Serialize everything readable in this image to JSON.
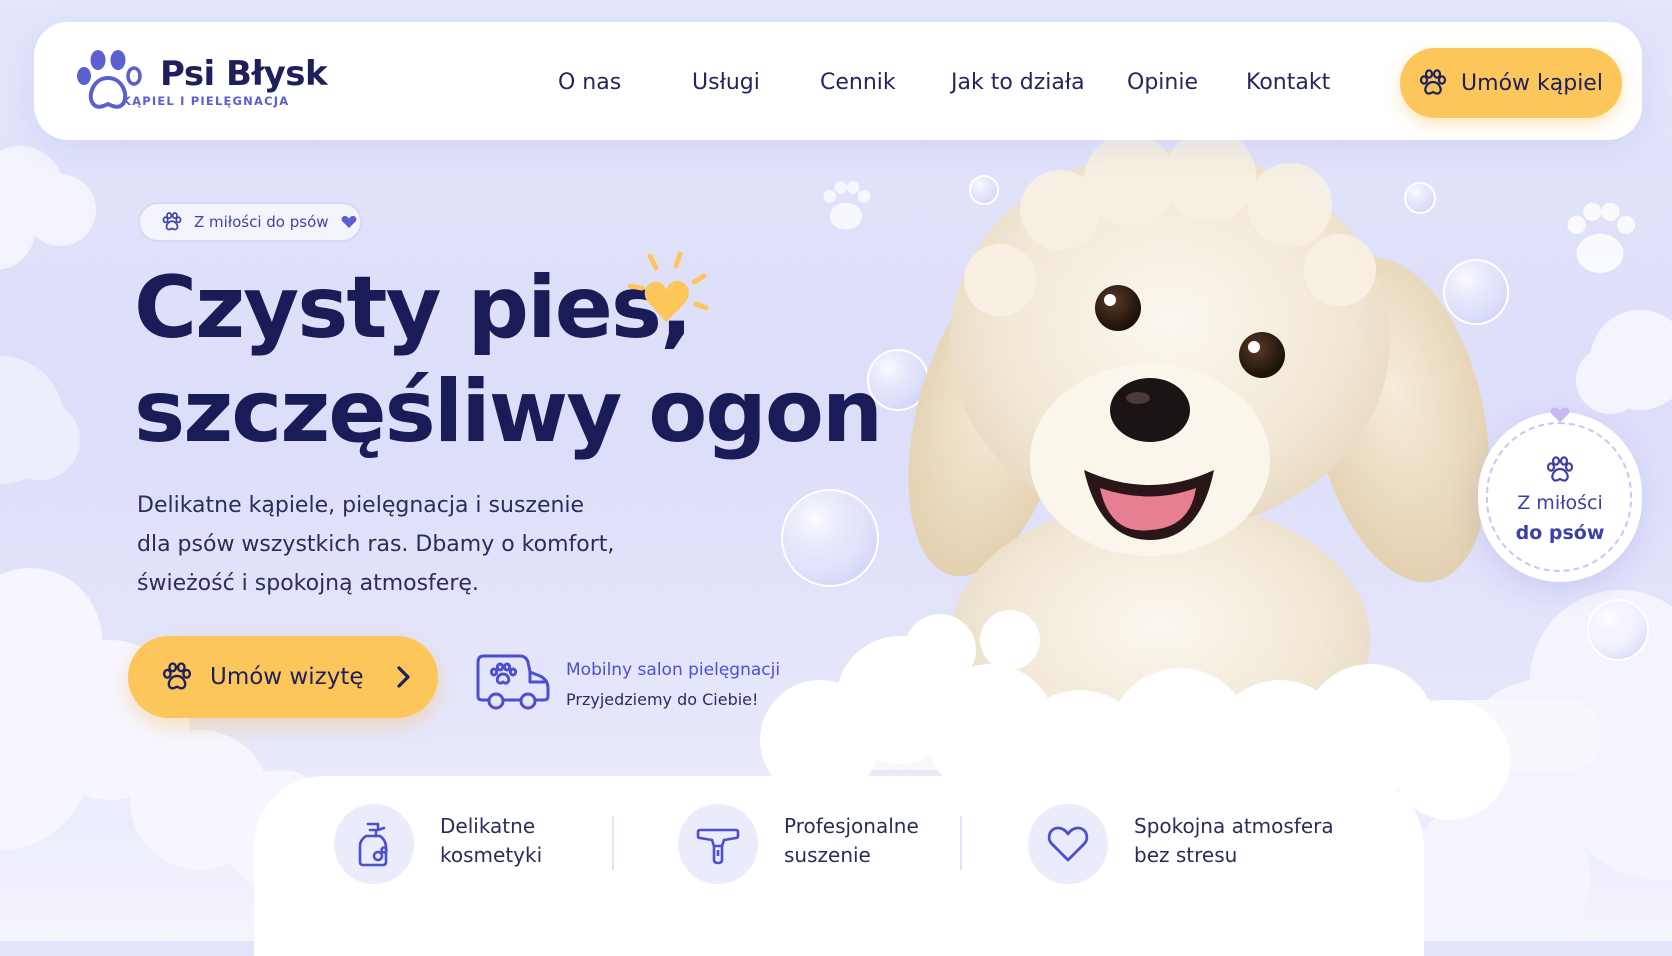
{
  "brand": {
    "name": "Psi Błysk",
    "tagline": "KĄPIEL I PIELĘGNACJA",
    "icon": "paw-icon"
  },
  "nav": {
    "links": [
      "O nas",
      "Usługi",
      "Cennik",
      "Jak to działa",
      "Opinie",
      "Kontakt"
    ],
    "cta_label": "Umów kąpiel",
    "cta_icon": "paw-icon"
  },
  "hero": {
    "pill_text": "Z miłości do psów",
    "headline": [
      "Czysty pies,",
      "szczęśliwy ogon"
    ],
    "description": [
      "Delikatne kąpiele, pielęgnacja i suszenie",
      "dla psów wszystkich ras. Dbamy o komfort,",
      "świeżość i spokojną atmosferę."
    ],
    "cta_label": "Umów wizytę",
    "mobile_title": "Mobilny salon pielęgnacji",
    "mobile_subtitle": "Przyjedziemy do Ciebie!"
  },
  "badge": {
    "lines": [
      "Z miłości",
      "do psów"
    ]
  },
  "features": [
    {
      "icon": "shampoo-bottle-icon",
      "lines": [
        "Delikatne",
        "kosmetyki"
      ]
    },
    {
      "icon": "hair-dryer-icon",
      "lines": [
        "Profesjonalne",
        "suszenie"
      ]
    },
    {
      "icon": "heart-icon",
      "lines": [
        "Spokojna atmosfera",
        "bez stresu"
      ]
    }
  ],
  "colors": {
    "accent": "#fcc65b",
    "brand": "#5b5fd0",
    "text_dark": "#1a1c58",
    "background": "#dcdefa"
  }
}
